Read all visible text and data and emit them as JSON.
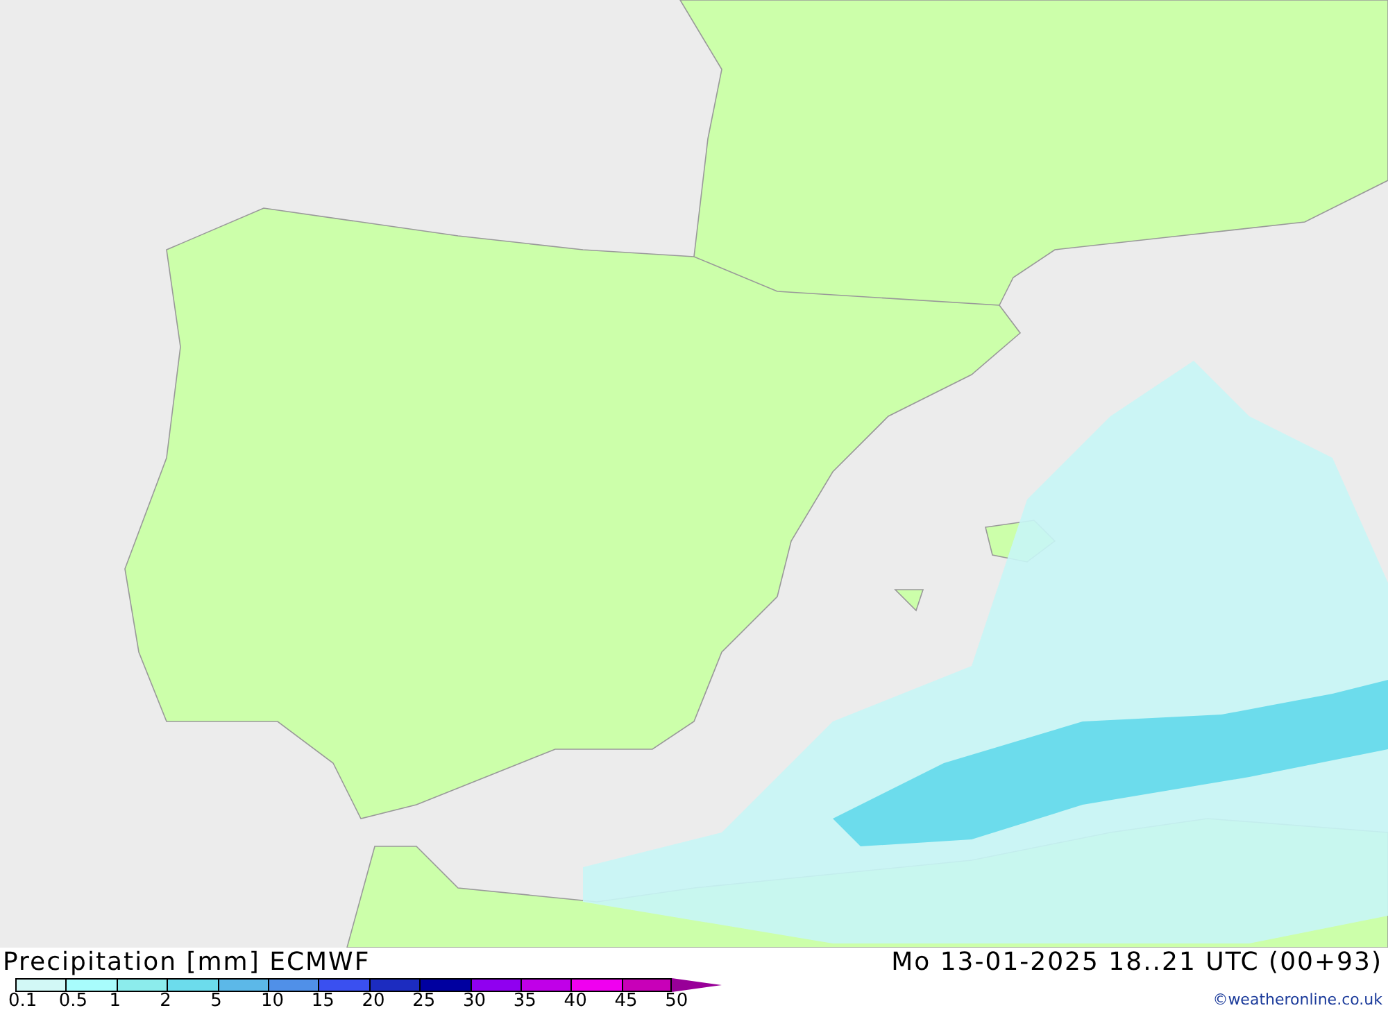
{
  "map": {
    "title": "Precipitation [mm] ECMWF",
    "valid_time": "Mo 13-01-2025 18..21 UTC (00+93)"
  },
  "legend": {
    "bins": [
      {
        "color": "#d2f8f6"
      },
      {
        "color": "#a8fcfc"
      },
      {
        "color": "#8cecec"
      },
      {
        "color": "#6cdcec"
      },
      {
        "color": "#5cb8e8"
      },
      {
        "color": "#5090e8"
      },
      {
        "color": "#3a50f0"
      },
      {
        "color": "#1c2cc0"
      },
      {
        "color": "#0000a0"
      },
      {
        "color": "#9000f0"
      },
      {
        "color": "#c000e8"
      },
      {
        "color": "#f000f0"
      },
      {
        "color": "#c800b8"
      },
      {
        "kind": "arrow",
        "color": "#980098"
      }
    ],
    "labels": [
      "0.1",
      "0.5",
      "1",
      "2",
      "5",
      "10",
      "15",
      "20",
      "25",
      "30",
      "35",
      "40",
      "45",
      "50"
    ]
  },
  "credit": "©weatheronline.co.uk"
}
